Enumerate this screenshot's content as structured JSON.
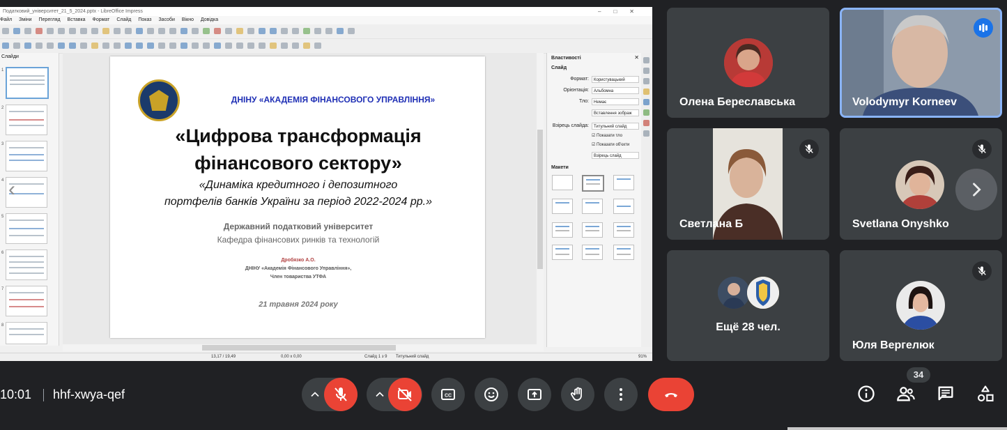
{
  "shared_screen": {
    "window_title": "Податковий_університет_21_5_2024.pptx - LibreOffice Impress",
    "menu": [
      "Файл",
      "Зміни",
      "Перегляд",
      "Вставка",
      "Формат",
      "Слайд",
      "Показ",
      "Засоби",
      "Вікно",
      "Довідка"
    ],
    "slides_panel_title": "Слайди",
    "slide_numbers": [
      "1",
      "2",
      "3",
      "4",
      "5",
      "6",
      "7",
      "8"
    ],
    "thumb_nav": "‹",
    "slide": {
      "org": "ДНІНУ «АКАДЕМІЯ ФІНАНСОВОГО УПРАВЛІННЯ»",
      "title_line1": "«Цифрова трансформація",
      "title_line2": "фінансового сектору»",
      "subtitle_line1": "«Динаміка кредитного і депозитного",
      "subtitle_line2": "портфелів банків України за період 2022-2024 рр.»",
      "university": "Державний податковий університет",
      "department": "Кафедра фінансових ринків та технологій",
      "author": "Дробязко А.О.",
      "author_org": "ДНІНУ «Академія Фінансового Управління»,",
      "author_member": "Член товариства УТФА",
      "date": "21 травня 2024 року"
    },
    "properties": {
      "title": "Властивості",
      "section_slide": "Слайд",
      "format_label": "Формат:",
      "format_value": "Користувацький",
      "orientation_label": "Орієнтація:",
      "orientation_value": "Альбомна",
      "background_label": "Тло:",
      "background_value": "Немає",
      "insert_image": "Вставлення зображ",
      "master_label": "Взірець слайда:",
      "master_value": "Титульний слайд",
      "show_bg": "Показати тло",
      "show_objects": "Показати об'єкти",
      "master_button": "Взірець слайд",
      "section_layouts": "Макети"
    },
    "status": {
      "position": "13,17 / 19,49",
      "size": "0,00 x 0,00",
      "slide_of": "Слайд 1 з 9",
      "layout_name": "Титульний слайд",
      "zoom": "91%"
    }
  },
  "participants": [
    {
      "name": "Олена Береславська",
      "muted": false
    },
    {
      "name": "Volodymyr Korneev",
      "muted": false,
      "speaking": true
    },
    {
      "name": "Светлана Б",
      "muted": true
    },
    {
      "name": "Svetlana Onyshko",
      "muted": true
    },
    {
      "name": "Ещё 28 чел.",
      "muted": false
    },
    {
      "name": "Юля Вергелюк",
      "muted": true
    }
  ],
  "next_page_icon": "chevron-right-icon",
  "meeting": {
    "time": "10:01",
    "code": "hhf-xwya-qef",
    "participant_count": "34"
  },
  "colors": {
    "background": "#202124",
    "tile": "#3c4043",
    "red": "#ea4335",
    "speaking_border": "#8ab4f8"
  }
}
